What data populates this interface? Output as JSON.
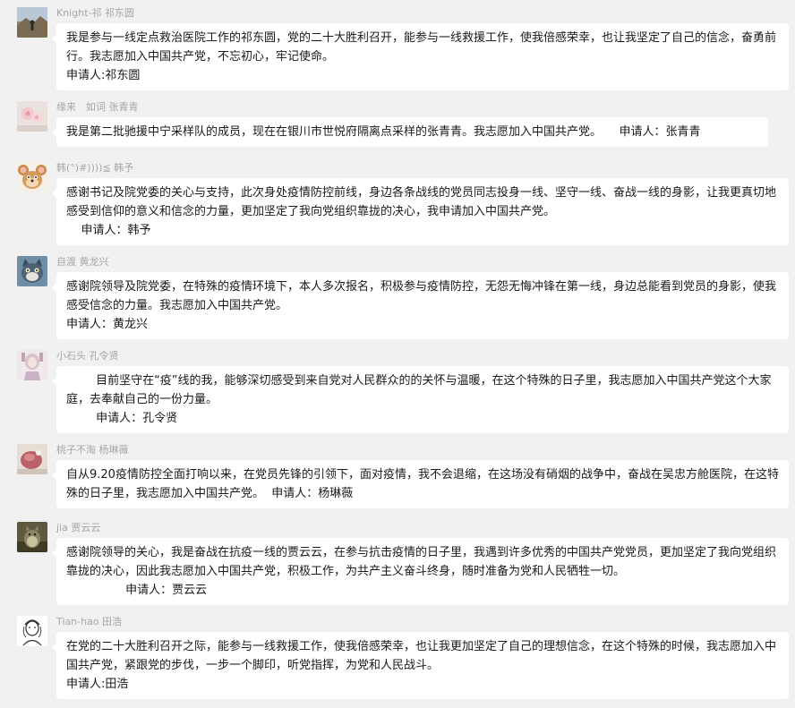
{
  "messages": [
    {
      "sender": "Knight-祁 祁东圆",
      "avatar": "avatar-mountain-photo",
      "text": "我是参与一线定点救治医院工作的祁东圆，党的二十大胜利召开，能参与一线救援工作，使我倍感荣幸，也让我坚定了自己的信念，奋勇前行。我志愿加入中国共产党，不忘初心，牢记使命。\n申请人:祁东圆"
    },
    {
      "sender": "缘来　如词 张青青",
      "avatar": "avatar-flower-photo",
      "text": "我是第二批驰援中宁采样队的成员，现在在银川市世悦府隔离点采样的张青青。我志愿加入中国共产党。　　申请人：张青青"
    },
    {
      "sender": "韩(°)#))))≦ 韩予",
      "avatar": "avatar-cartoon-mouse",
      "text": "感谢书记及院党委的关心与支持，此次身处疫情防控前线，身边各条战线的党员同志投身一线、坚守一线、奋战一线的身影，让我更真切地感受到信仰的意义和信念的力量，更加坚定了我向党组织靠拢的决心，我申请加入中国共产党。\n    申请人：韩予"
    },
    {
      "sender": "自渡 黄龙兴",
      "avatar": "avatar-cartoon-cat",
      "text": "感谢院领导及院党委，在特殊的疫情环境下，本人多次报名，积极参与疫情防控，无怨无悔冲锋在第一线，身边总能看到党员的身影，使我感受信念的力量。我志愿加入中国共产党。\n申请人：黄龙兴"
    },
    {
      "sender": "小石头 孔令贤",
      "avatar": "avatar-girl-photo",
      "text": "        目前坚守在“疫”线的我，能够深切感受到来自党对人民群众的的关怀与温暖，在这个特殊的日子里，我志愿加入中国共产党这个大家庭，去奉献自己的一份力量。\n        申请人：孔令贤"
    },
    {
      "sender": "桃子不淘 杨琳薇",
      "avatar": "avatar-dessert-photo",
      "text": "自从9.20疫情防控全面打响以来，在党员先锋的引领下，面对疫情，我不会退缩，在这场没有硝烟的战争中，奋战在吴忠方舱医院，在这特殊的日子里，我志愿加入中国共产党。  申请人：杨琳薇"
    },
    {
      "sender": "jia 贾云云",
      "avatar": "avatar-totoro-photo",
      "text": "感谢院领导的关心，我是奋战在抗疫一线的贾云云，在参与抗击疫情的日子里，我遇到许多优秀的中国共产党党员，更加坚定了我向党组织靠拢的决心，因此我志愿加入中国共产党，积极工作，为共产主义奋斗终身，随时准备为党和人民牺牲一切。\n                申请人：贾云云"
    },
    {
      "sender": "Tian-hao 田浩",
      "avatar": "avatar-sketch-portrait",
      "text": "在党的二十大胜利召开之际，能参与一线救援工作，使我倍感荣幸，也让我更加坚定了自己的理想信念，在这个特殊的时候，我志愿加入中国共产党，紧跟党的步伐，一步一个脚印，听党指挥，为党和人民战斗。\n申请人:田浩"
    }
  ]
}
